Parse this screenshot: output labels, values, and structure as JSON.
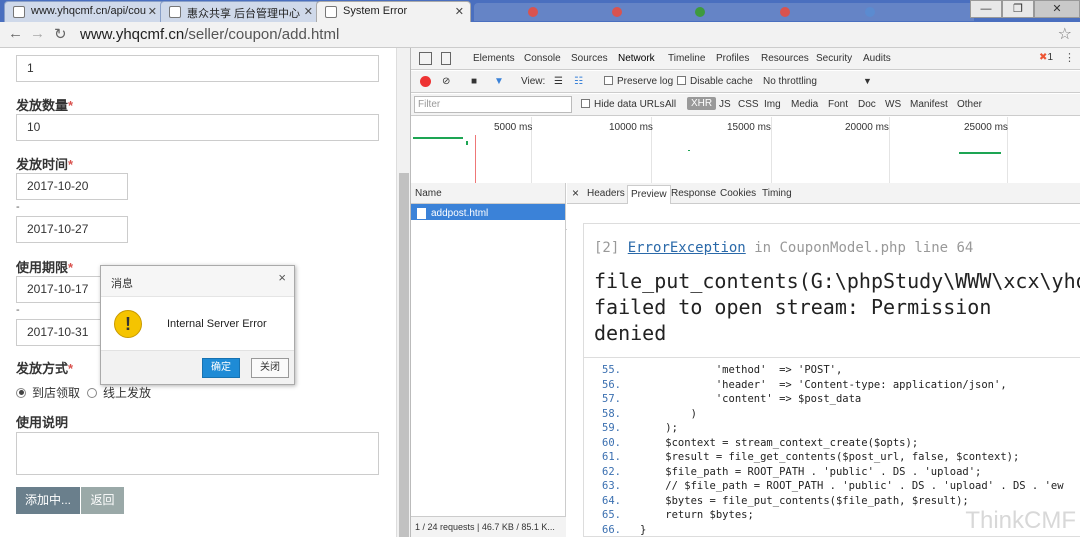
{
  "tabs": [
    {
      "label": "www.yhqcmf.cn/api/cou"
    },
    {
      "label": "惠众共享 后台管理中心"
    },
    {
      "label": "System Error"
    }
  ],
  "window_controls": {
    "minimize": "—",
    "restore": "❐",
    "close": "✕"
  },
  "address": {
    "host": "www.yhqcmf.cn",
    "path": "/seller/coupon/add.html"
  },
  "form": {
    "prev_value": "1",
    "quantity_label": "发放数量",
    "quantity_value": "10",
    "issue_time_label": "发放时间",
    "issue_start": "2017-10-20",
    "issue_end": "2017-10-27",
    "use_period_label": "使用期限",
    "use_start": "2017-10-17",
    "use_end": "2017-10-31",
    "method_label": "发放方式",
    "method_options": [
      "到店领取",
      "线上发放"
    ],
    "method_selected": 0,
    "desc_label": "使用说明",
    "required_mark": "*",
    "range_sep": "-",
    "adding_button": "添加中...",
    "back_button": "返回"
  },
  "modal": {
    "title": "消息",
    "message": "Internal Server Error",
    "ok": "确定",
    "cancel": "关闭",
    "close_glyph": "×",
    "warn_glyph": "!"
  },
  "devtools": {
    "tabs": [
      "Elements",
      "Console",
      "Sources",
      "Network",
      "Timeline",
      "Profiles",
      "Resources",
      "Security",
      "Audits"
    ],
    "selected_tab": "Network",
    "error_count": "1",
    "error_glyph": "✖",
    "more_glyph": "⋮",
    "toolbar": {
      "view_label": "View:",
      "preserve_log": "Preserve log",
      "disable_cache": "Disable cache",
      "throttling": "No throttling",
      "dropdown_glyph": "▼"
    },
    "filter": {
      "placeholder": "Filter",
      "hide_data_urls": "Hide data URLs",
      "types": [
        "All",
        "XHR",
        "JS",
        "CSS",
        "Img",
        "Media",
        "Font",
        "Doc",
        "WS",
        "Manifest",
        "Other"
      ],
      "selected_type": "XHR"
    },
    "timeline_ticks": [
      "5000 ms",
      "10000 ms",
      "15000 ms",
      "20000 ms",
      "25000 ms"
    ],
    "name_header": "Name",
    "request_name": "addpost.html",
    "status_bar": "1 / 24 requests  |  46.7 KB / 85.1 K...",
    "detail_tabs": [
      "Headers",
      "Preview",
      "Response",
      "Cookies",
      "Timing"
    ],
    "selected_detail_tab": "Preview",
    "detail_close": "×",
    "error": {
      "index": "[2]",
      "exception": "ErrorException",
      "in_text": "in",
      "location": "CouponModel.php line 64",
      "message": "file_put_contents(G:\\phpStudy\\WWW\\xcx\\yhq\\public\\upload): failed to open stream: Permission denied"
    },
    "code_lines": [
      {
        "n": "55.",
        "code": "            'method'  => 'POST',"
      },
      {
        "n": "56.",
        "code": "            'header'  => 'Content-type: application/json',"
      },
      {
        "n": "57.",
        "code": "            'content' => $post_data"
      },
      {
        "n": "58.",
        "code": "        )"
      },
      {
        "n": "59.",
        "code": "    );"
      },
      {
        "n": "60.",
        "code": "    $context = stream_context_create($opts);"
      },
      {
        "n": "61.",
        "code": "    $result = file_get_contents($post_url, false, $context);"
      },
      {
        "n": "62.",
        "code": "    $file_path = ROOT_PATH . 'public' . DS . 'upload';"
      },
      {
        "n": "63.",
        "code": "    // $file_path = ROOT_PATH . 'public' . DS . 'upload' . DS . 'ew"
      },
      {
        "n": "64.",
        "code": "    $bytes = file_put_contents($file_path, $result);"
      },
      {
        "n": "65.",
        "code": "    return $bytes;"
      },
      {
        "n": "66.",
        "code": "}"
      }
    ]
  },
  "watermark": "ThinkCMF"
}
